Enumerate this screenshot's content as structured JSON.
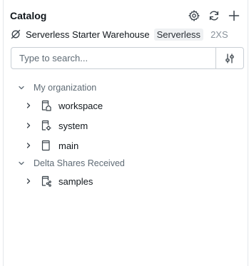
{
  "panel": {
    "title": "Catalog"
  },
  "header_actions": {
    "settings_icon": "gear-icon",
    "refresh_icon": "refresh-icon",
    "add_icon": "plus-icon"
  },
  "warehouse": {
    "icon": "no-connection-icon",
    "name": "Serverless Starter Warehouse",
    "type_badge": "Serverless",
    "size": "2XS"
  },
  "search": {
    "placeholder": "Type to search...",
    "value": "",
    "filter_icon": "filter-sliders-icon"
  },
  "tree": {
    "sections": [
      {
        "label": "My organization",
        "expanded": true,
        "items": [
          {
            "label": "workspace",
            "icon": "catalog-home-icon"
          },
          {
            "label": "system",
            "icon": "catalog-gear-icon"
          },
          {
            "label": "main",
            "icon": "catalog-icon"
          }
        ]
      },
      {
        "label": "Delta Shares Received",
        "expanded": true,
        "items": [
          {
            "label": "samples",
            "icon": "catalog-shared-icon"
          }
        ]
      }
    ]
  }
}
